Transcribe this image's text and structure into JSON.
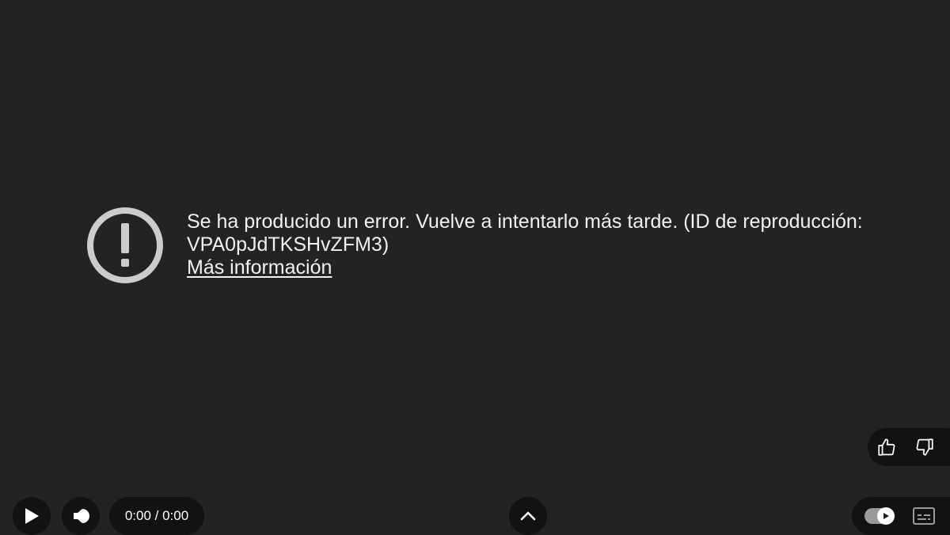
{
  "player": {
    "error": {
      "icon": "exclamation-circle-icon",
      "message_line1": "Se ha producido un error. Vuelve a intentarlo más tarde. (ID de reproducción:",
      "message_line2": "VPA0pJdTKSHvZFM3)",
      "link_label": "Más información"
    },
    "rating": {
      "like_icon": "thumbs-up-icon",
      "dislike_icon": "thumbs-down-icon"
    },
    "controls": {
      "play_icon": "play-icon",
      "volume_icon": "volume-icon",
      "time_display": "0:00 / 0:00",
      "expand_icon": "chevron-up-icon",
      "autoplay_icon": "autoplay-toggle-icon",
      "captions_icon": "captions-icon"
    },
    "colors": {
      "background": "#232323",
      "control_bg": "#121212",
      "text": "#f1f1f1",
      "icon_gray": "#cccccc"
    }
  }
}
